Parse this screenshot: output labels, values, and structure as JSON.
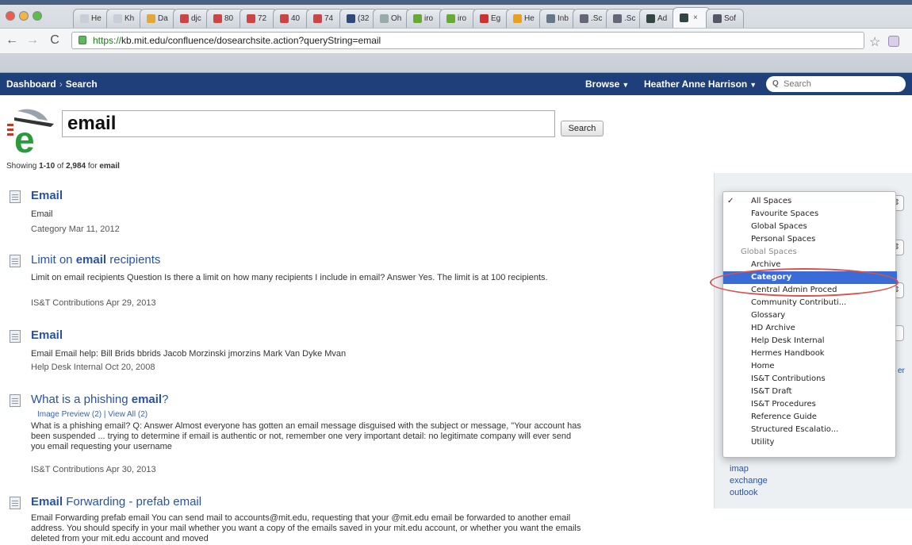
{
  "browser": {
    "tabs": [
      {
        "label": "He"
      },
      {
        "label": "Kh"
      },
      {
        "label": "Da"
      },
      {
        "label": "djc"
      },
      {
        "label": "80"
      },
      {
        "label": "72"
      },
      {
        "label": "40"
      },
      {
        "label": "74"
      },
      {
        "label": "(32"
      },
      {
        "label": "Oh"
      },
      {
        "label": "iro"
      },
      {
        "label": "iro"
      },
      {
        "label": "Eg"
      },
      {
        "label": "He"
      },
      {
        "label": "Inb"
      },
      {
        "label": ".Sc"
      },
      {
        "label": ".Sc"
      },
      {
        "label": "Ad"
      },
      {
        "label": ""
      },
      {
        "label": "Sof"
      }
    ],
    "url_secure": "https://",
    "url_rest": "kb.mit.edu/confluence/dosearchsite.action?queryString=email"
  },
  "appnav": {
    "dashboard": "Dashboard",
    "separator": "›",
    "search": "Search",
    "browse": "Browse",
    "user": "Heather Anne Harrison",
    "search_placeholder": "Search"
  },
  "search": {
    "query": "email",
    "button": "Search",
    "showing_prefix": "Showing ",
    "showing_range": "1-10",
    "showing_of": " of ",
    "showing_total": "2,984",
    "showing_for": " for ",
    "showing_term": "email"
  },
  "results": [
    {
      "title_pre": "",
      "title_bold": "Email",
      "title_post": "",
      "excerpt": "Email",
      "meta": "Category  Mar 11, 2012"
    },
    {
      "title_pre": "Limit on ",
      "title_bold": "email",
      "title_post": " recipients",
      "excerpt": "Limit on email recipients Question Is there a limit on how many recipients I include in email? Answer Yes. The limit is at 100 recipients.",
      "meta": "IS&T Contributions  Apr 29, 2013"
    },
    {
      "title_pre": "",
      "title_bold": "Email",
      "title_post": "",
      "excerpt": "Email Email help: Bill Brids bbrids Jacob Morzinski jmorzins Mark Van Dyke Mvan",
      "meta": "Help Desk Internal  Oct 20, 2008"
    },
    {
      "title_pre": "What is a phishing ",
      "title_bold": "email",
      "title_post": "?",
      "sub": "Image Preview (2)   |   View All (2)",
      "excerpt": "What is a phishing email? Q: Answer Almost everyone has gotten an email message disguised with the subject or message, \"Your account has been suspended ... trying to determine if email is authentic or not, remember one very important detail: no legitimate company will ever send you email requesting your username",
      "meta": "IS&T Contributions  Apr 30, 2013"
    },
    {
      "title_pre": "",
      "title_bold": "Email",
      "title_post": " Forwarding - prefab email",
      "excerpt": "Email Forwarding prefab email You can send mail to accounts@mit.edu, requesting that your @mit.edu email be forwarded to another email address. You should specify in your mail whether you want a copy of the emails saved in your mit.edu account, or whether you want the emails deleted from your mit.edu account and moved"
    }
  ],
  "dropdown": {
    "check": "✓",
    "items": [
      {
        "label": "All Spaces",
        "type": "option",
        "checked": true
      },
      {
        "label": "Favourite Spaces",
        "type": "option"
      },
      {
        "label": "Global Spaces",
        "type": "option"
      },
      {
        "label": "Personal Spaces",
        "type": "option"
      },
      {
        "label": "Global Spaces",
        "type": "header"
      },
      {
        "label": "Archive",
        "type": "option"
      },
      {
        "label": "Category",
        "type": "option",
        "selected": true
      },
      {
        "label": "Central Admin Proced",
        "type": "option"
      },
      {
        "label": "Community Contributi...",
        "type": "option"
      },
      {
        "label": "Glossary",
        "type": "option"
      },
      {
        "label": "HD Archive",
        "type": "option"
      },
      {
        "label": "Help Desk Internal",
        "type": "option"
      },
      {
        "label": "Hermes Handbook",
        "type": "option"
      },
      {
        "label": "Home",
        "type": "option"
      },
      {
        "label": "IS&T Contributions",
        "type": "option"
      },
      {
        "label": "IS&T Draft",
        "type": "option"
      },
      {
        "label": "IS&T Procedures",
        "type": "option"
      },
      {
        "label": "Reference Guide",
        "type": "option"
      },
      {
        "label": "Structured Escalatio...",
        "type": "option"
      },
      {
        "label": "Utility",
        "type": "option"
      }
    ]
  },
  "sidepanel": {
    "links": [
      "imap",
      "exchange",
      "outlook"
    ],
    "partial_label": "er"
  },
  "colors": {
    "nav_bg": "#1f3f7a",
    "link": "#2952a3",
    "selected": "#3a6cd8",
    "highlight_ring": "#d9514c"
  }
}
